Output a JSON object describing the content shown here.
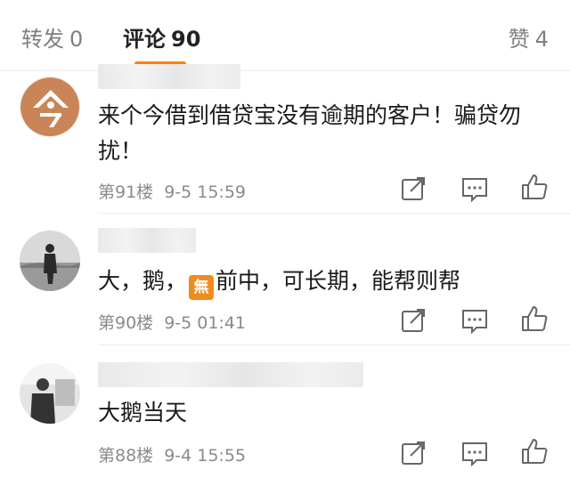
{
  "tabs": {
    "repost": {
      "label": "转发",
      "count": "0"
    },
    "comment": {
      "label": "评论",
      "count": "90"
    },
    "like": {
      "label": "赞",
      "count": "4"
    }
  },
  "accent_color": "#ff8200",
  "comments": [
    {
      "text": "来个今借到借贷宝没有逾期的客户！骗贷勿扰！",
      "floor": "第91楼",
      "date": "9-5 15:59",
      "avatar_glyph": "今",
      "avatar_color": "#b8744a"
    },
    {
      "text_before": "大，鹅，",
      "emoji": "無",
      "text_after": "前中，可长期，能帮则帮",
      "floor": "第90楼",
      "date": "9-5 01:41"
    },
    {
      "text": "大鹅当天",
      "floor": "第88楼",
      "date": "9-4 15:55"
    }
  ],
  "icons": {
    "share": "share-icon",
    "comment": "comment-icon",
    "like": "thumbs-up-icon"
  }
}
